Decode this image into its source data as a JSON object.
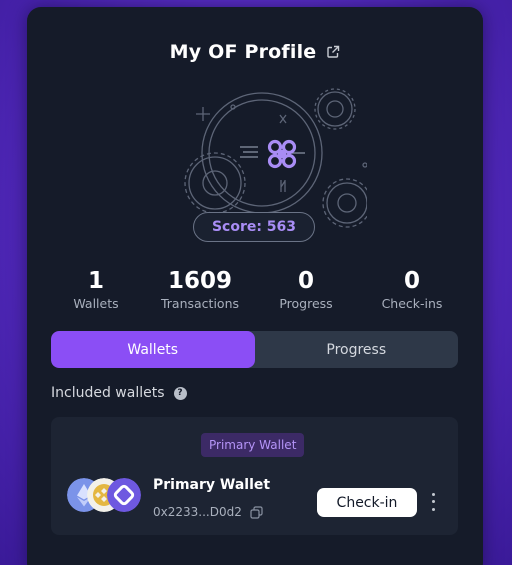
{
  "profile": {
    "title": "My OF Profile",
    "score_label": "Score: 563"
  },
  "stats": [
    {
      "value": "1",
      "label": "Wallets"
    },
    {
      "value": "1609",
      "label": "Transactions"
    },
    {
      "value": "0",
      "label": "Progress"
    },
    {
      "value": "0",
      "label": "Check-ins"
    }
  ],
  "tabs": [
    {
      "label": "Wallets",
      "active": true
    },
    {
      "label": "Progress",
      "active": false
    }
  ],
  "included": {
    "heading": "Included wallets",
    "help_glyph": "?"
  },
  "wallet": {
    "badge": "Primary Wallet",
    "name": "Primary Wallet",
    "address": "0x2233...D0d2",
    "checkin_label": "Check-in",
    "icons": [
      "ethereum-icon",
      "bnb-icon",
      "chain-icon"
    ]
  },
  "colors": {
    "accent": "#8b4ef5",
    "score_text": "#a98df5",
    "card_bg": "#151b29"
  }
}
